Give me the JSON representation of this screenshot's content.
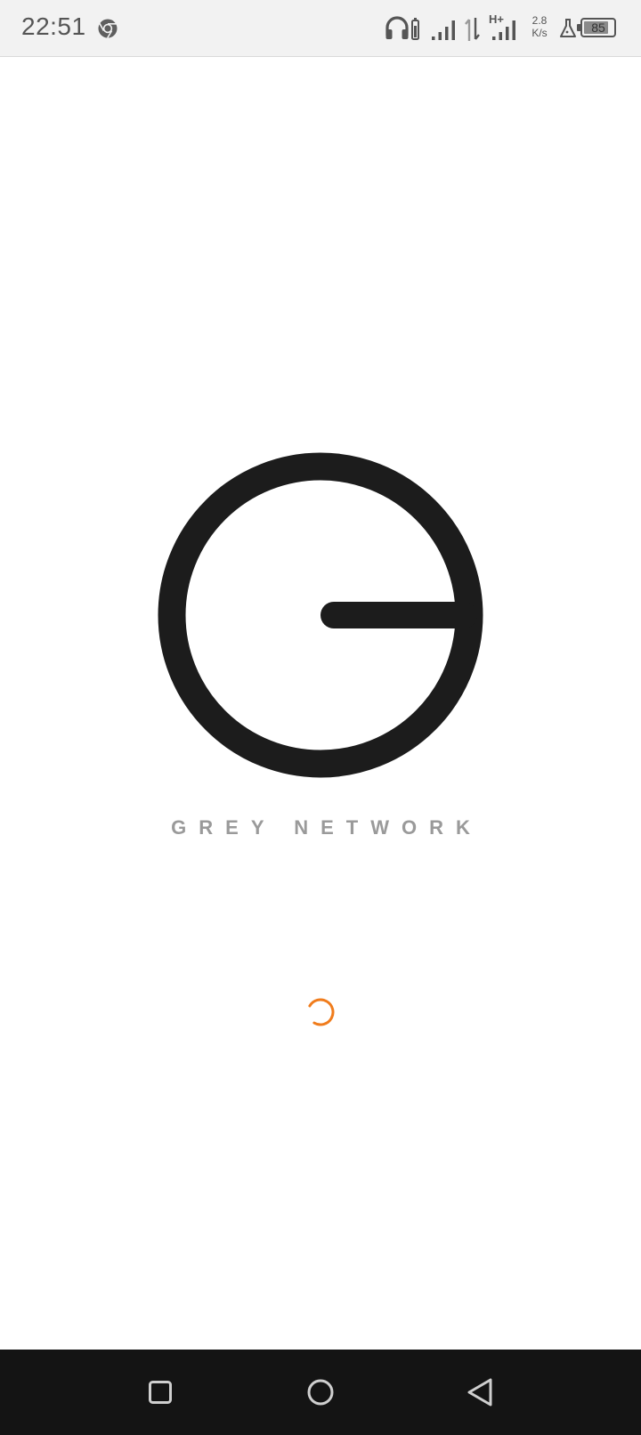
{
  "status_bar": {
    "time": "22:51",
    "net_speed_value": "2.8",
    "net_speed_unit": "K/s",
    "network_type": "H+",
    "battery_level": "85",
    "battery_fraction": 0.85,
    "icons": [
      "chrome-icon",
      "headset-icon",
      "signal-icon",
      "data-transfer-icon",
      "signal-icon",
      "lab-flask-icon",
      "battery-icon"
    ]
  },
  "splash": {
    "brand_name": "GREY NETWORK",
    "logo_icon": "grey-network-logo",
    "spinner_color": "#f07c1c"
  },
  "nav_bar": {
    "buttons": [
      "recents-button",
      "home-button",
      "back-button"
    ]
  },
  "colors": {
    "logo": "#1c1c1c",
    "brand_text": "#9a9a9a",
    "nav_background": "#141414",
    "status_background": "#f2f2f2"
  }
}
